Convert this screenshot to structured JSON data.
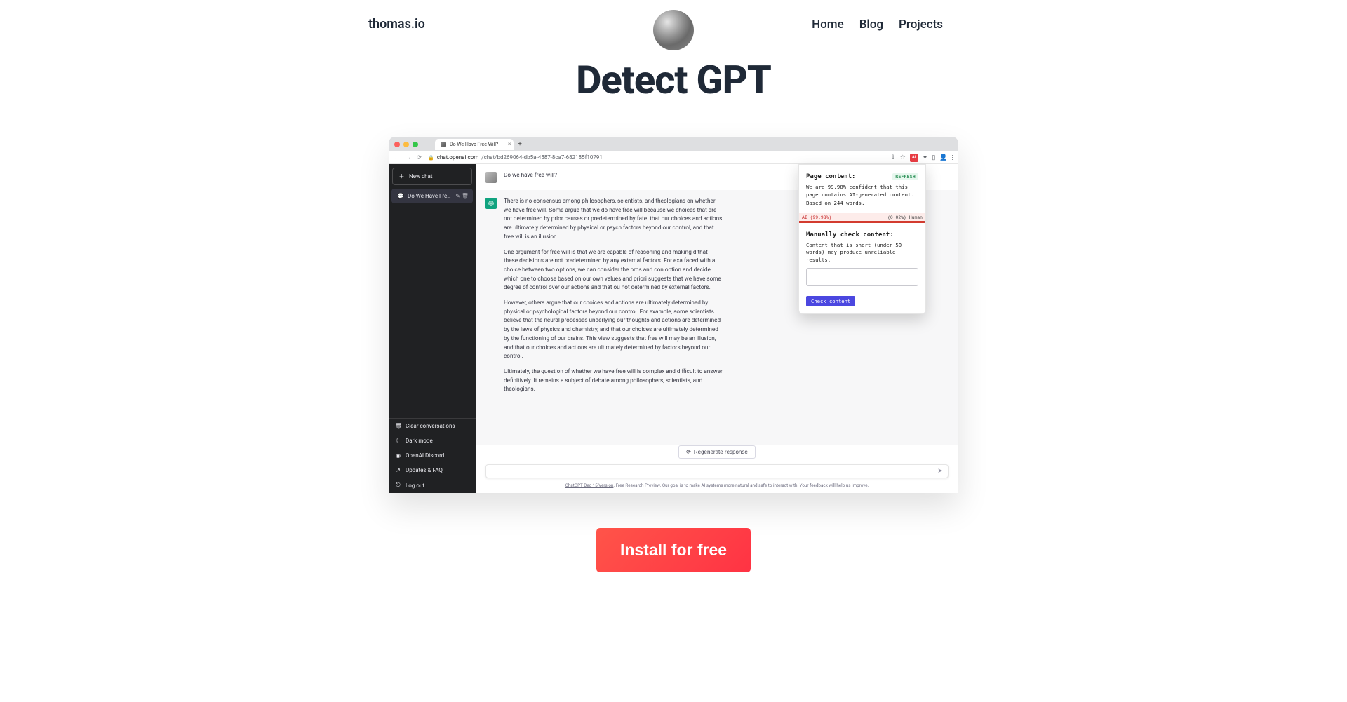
{
  "brand": "thomas.io",
  "nav": {
    "home": "Home",
    "blog": "Blog",
    "projects": "Projects"
  },
  "title": "Detect GPT",
  "browser": {
    "tab_title": "Do We Have Free Will?",
    "url_host": "chat.openai.com",
    "url_path": "/chat/bd269064-db5a-4587-8ca7-682185f10791",
    "ext_label": "AI"
  },
  "sidebar": {
    "new_chat": "New chat",
    "history_item": "Do We Have Free Will?",
    "clear": "Clear conversations",
    "dark": "Dark mode",
    "discord": "OpenAI Discord",
    "updates": "Updates & FAQ",
    "logout": "Log out"
  },
  "chat": {
    "user_msg": "Do we have free will?",
    "ai_p1": "There is no consensus among philosophers, scientists, and theologians on whether we have free will. Some argue that we do have free will because we choices that are not determined by prior causes or predetermined by fate. that our choices and actions are ultimately determined by physical or psych factors beyond our control, and that free will is an illusion.",
    "ai_p2": "One argument for free will is that we are capable of reasoning and making d that these decisions are not predetermined by any external factors. For exa faced with a choice between two options, we can consider the pros and con option and decide which one to choose based on our own values and priori suggests that we have some degree of control over our actions and that ou not determined by external factors.",
    "ai_p3": "However, others argue that our choices and actions are ultimately determined by physical or psychological factors beyond our control. For example, some scientists believe that the neural processes underlying our thoughts and actions are determined by the laws of physics and chemistry, and that our choices are ultimately determined by the functioning of our brains. This view suggests that free will may be an illusion, and that our choices and actions are ultimately determined by factors beyond our control.",
    "ai_p4": "Ultimately, the question of whether we have free will is complex and difficult to answer definitively. It remains a subject of debate among philosophers, scientists, and theologians.",
    "regen": "Regenerate response",
    "footer_link": "ChatGPT Dec 15 Version",
    "footer_text": ". Free Research Preview. Our goal is to make AI systems more natural and safe to interact with. Your feedback will help us improve."
  },
  "popup": {
    "page_content_label": "Page content:",
    "refresh": "REFRESH",
    "confidence": "We are 99.98% confident that this page contains AI-generated content.",
    "words": "Based on 244 words.",
    "ai_pct": "AI (99.98%)",
    "human_pct": "(0.02%) Human",
    "manual_label": "Manually check content:",
    "manual_hint": "Content that is short (under 50 words) may produce unreliable results.",
    "check_btn": "Check content"
  },
  "cta": "Install for free"
}
